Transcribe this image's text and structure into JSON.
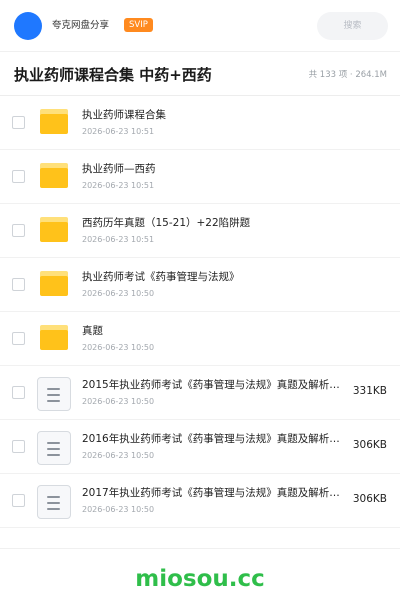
{
  "header": {
    "username": "夸克网盘分享",
    "badge": "SVIP",
    "search_label": "搜索"
  },
  "folder": {
    "title": "执业药师课程合集 中药+西药",
    "stats": "共 133 项 · 264.1M"
  },
  "items": [
    {
      "type": "folder",
      "name": "执业药师课程合集",
      "date": "2026-06-23 10:51",
      "size": ""
    },
    {
      "type": "folder",
      "name": "执业药师—西药",
      "date": "2026-06-23 10:51",
      "size": ""
    },
    {
      "type": "folder",
      "name": "西药历年真题（15-21）+22陷阱题",
      "date": "2026-06-23 10:51",
      "size": ""
    },
    {
      "type": "folder",
      "name": "执业药师考试《药事管理与法规》",
      "date": "2026-06-23 10:50",
      "size": ""
    },
    {
      "type": "folder",
      "name": "真题",
      "date": "2026-06-23 10:50",
      "size": ""
    },
    {
      "type": "file",
      "name": "2015年执业药师考试《药事管理与法规》真题及解析…",
      "date": "2026-06-23 10:50",
      "size": "331KB"
    },
    {
      "type": "file",
      "name": "2016年执业药师考试《药事管理与法规》真题及解析…",
      "date": "2026-06-23 10:50",
      "size": "306KB"
    },
    {
      "type": "file",
      "name": "2017年执业药师考试《药事管理与法规》真题及解析…",
      "date": "2026-06-23 10:50",
      "size": "306KB"
    }
  ],
  "watermark": "miosou.cc",
  "colors": {
    "avatar": "#1f78ff",
    "badge": "#ff8a1f",
    "folder": "#ffc21a",
    "watermark": "#2fbe4a"
  }
}
